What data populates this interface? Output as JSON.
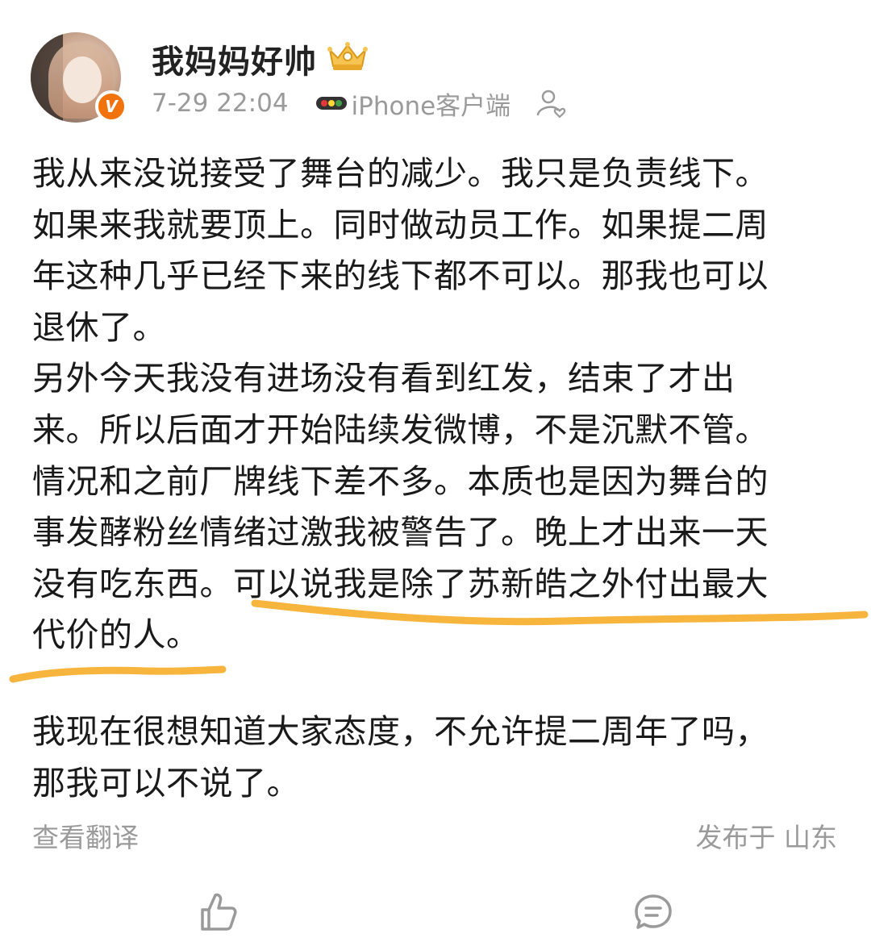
{
  "post": {
    "username": "我妈妈好帅",
    "time": "7-29 22:04",
    "client": "iPhone客户端",
    "verified_mark": "V",
    "paragraphs": {
      "p1": "我从来没说接受了舞台的减少。我只是负责线下。\n如果来我就要顶上。同时做动员工作。如果提二周\n年这种几乎已经下来的线下都不可以。那我也可以\n退休了。",
      "p2": "另外今天我没有进场没有看到红发，结束了才出\n来。所以后面才开始陆续发微博，不是沉默不管。\n情况和之前厂牌线下差不多。本质也是因为舞台的\n事发酵粉丝情绪过激我被警告了。晚上才出来一天\n没有吃东西。可以说我是除了苏新皓之外付出最大\n代价的人。",
      "p3": "我现在很想知道大家态度，不允许提二周年了吗，\n那我可以不说了。"
    },
    "translate_label": "查看翻译",
    "location_label": "发布于 山东"
  },
  "icons": {
    "crown": "crown-badge-icon",
    "client": "three-dots-client-icon",
    "follow": "person-heart-icon",
    "like": "thumbs-up-icon",
    "comment": "comment-bubble-icon"
  },
  "colors": {
    "highlight_underline": "#f7b53d",
    "verified_badge": "#f2720c",
    "meta_text": "#9a9a9a"
  }
}
